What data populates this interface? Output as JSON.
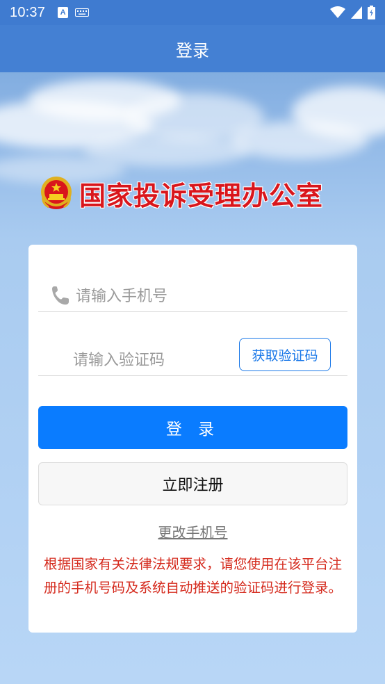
{
  "status_bar": {
    "time": "10:37",
    "notification_icon": "A",
    "icons": [
      "keyboard-icon",
      "wifi-icon",
      "signal-icon",
      "battery-charging-icon"
    ]
  },
  "app_bar": {
    "title": "登录"
  },
  "banner": {
    "title": "国家投诉受理办公室",
    "emblem": "national-emblem"
  },
  "form": {
    "phone_placeholder": "请输入手机号",
    "code_placeholder": "请输入验证码",
    "get_code_label": "获取验证码",
    "login_label": "登 录",
    "register_label": "立即注册",
    "change_phone_label": "更改手机号",
    "notice": "根据国家有关法律法规要求，请您使用在该平台注册的手机号码及系统自动推送的验证码进行登录。"
  },
  "colors": {
    "app_bar": "#4480d3",
    "primary_button": "#0a7cff",
    "accent": "#1a78e8",
    "notice_text": "#d52b1e",
    "banner_text": "#d9161c"
  }
}
